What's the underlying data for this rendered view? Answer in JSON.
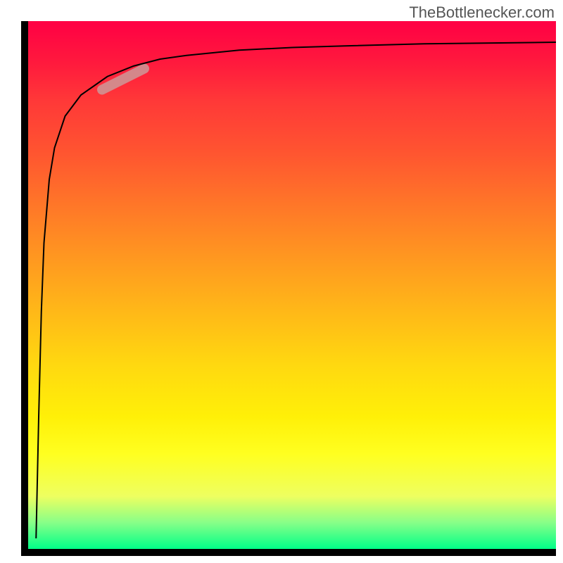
{
  "watermark": "TheBottlenecker.com",
  "chart_data": {
    "type": "line",
    "title": "",
    "xlabel": "",
    "ylabel": "",
    "xlim": [
      0,
      100
    ],
    "ylim": [
      0,
      100
    ],
    "series": [
      {
        "name": "curve",
        "x": [
          1.5,
          2,
          2.5,
          3,
          4,
          5,
          7,
          10,
          15,
          20,
          25,
          30,
          40,
          50,
          60,
          75,
          100
        ],
        "y": [
          2,
          25,
          45,
          58,
          70,
          76,
          82,
          86,
          89.5,
          91.5,
          92.8,
          93.5,
          94.5,
          95,
          95.3,
          95.7,
          96
        ]
      }
    ],
    "highlight_segment": {
      "x": [
        14,
        22
      ],
      "y": [
        87,
        91
      ]
    },
    "gradient_colors": {
      "top": "#ff0044",
      "middle": "#ffdd10",
      "bottom": "#00ff88"
    }
  }
}
